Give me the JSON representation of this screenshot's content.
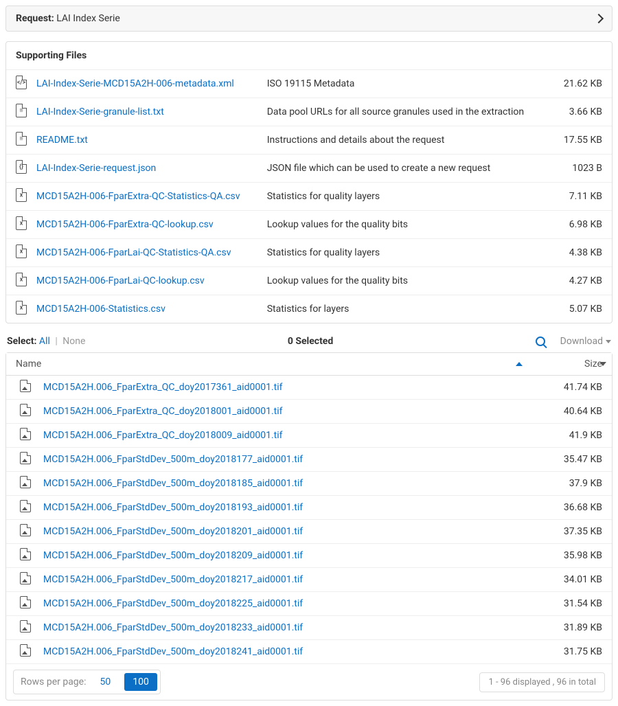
{
  "request": {
    "label": "Request:",
    "name": "LAI Index Serie"
  },
  "supporting": {
    "heading": "Supporting Files",
    "rows": [
      {
        "icon": "xml",
        "name": "LAI-Index-Serie-MCD15A2H-006-metadata.xml",
        "desc": "ISO 19115 Metadata",
        "size": "21.62 KB"
      },
      {
        "icon": "txt",
        "name": "LAI-Index-Serie-granule-list.txt",
        "desc": "Data pool URLs for all source granules used in the extraction",
        "size": "3.66 KB"
      },
      {
        "icon": "txt",
        "name": "README.txt",
        "desc": "Instructions and details about the request",
        "size": "17.55 KB"
      },
      {
        "icon": "json",
        "name": "LAI-Index-Serie-request.json",
        "desc": "JSON file which can be used to create a new request",
        "size": "1023 B"
      },
      {
        "icon": "csv",
        "name": "MCD15A2H-006-FparExtra-QC-Statistics-QA.csv",
        "desc": "Statistics for quality layers",
        "size": "7.11 KB"
      },
      {
        "icon": "csv",
        "name": "MCD15A2H-006-FparExtra-QC-lookup.csv",
        "desc": "Lookup values for the quality bits",
        "size": "6.98 KB"
      },
      {
        "icon": "csv",
        "name": "MCD15A2H-006-FparLai-QC-Statistics-QA.csv",
        "desc": "Statistics for quality layers",
        "size": "4.38 KB"
      },
      {
        "icon": "csv",
        "name": "MCD15A2H-006-FparLai-QC-lookup.csv",
        "desc": "Lookup values for the quality bits",
        "size": "4.27 KB"
      },
      {
        "icon": "csv",
        "name": "MCD15A2H-006-Statistics.csv",
        "desc": "Statistics for layers",
        "size": "5.07 KB"
      }
    ]
  },
  "toolbar": {
    "select_label": "Select:",
    "all": "All",
    "none": "None",
    "selected": "0 Selected",
    "download": "Download"
  },
  "data": {
    "columns": {
      "name": "Name",
      "size": "Size"
    },
    "rows": [
      {
        "name": "MCD15A2H.006_FparExtra_QC_doy2017361_aid0001.tif",
        "size": "41.74 KB"
      },
      {
        "name": "MCD15A2H.006_FparExtra_QC_doy2018001_aid0001.tif",
        "size": "40.64 KB"
      },
      {
        "name": "MCD15A2H.006_FparExtra_QC_doy2018009_aid0001.tif",
        "size": "41.9 KB"
      },
      {
        "name": "MCD15A2H.006_FparStdDev_500m_doy2018177_aid0001.tif",
        "size": "35.47 KB"
      },
      {
        "name": "MCD15A2H.006_FparStdDev_500m_doy2018185_aid0001.tif",
        "size": "37.9 KB"
      },
      {
        "name": "MCD15A2H.006_FparStdDev_500m_doy2018193_aid0001.tif",
        "size": "36.68 KB"
      },
      {
        "name": "MCD15A2H.006_FparStdDev_500m_doy2018201_aid0001.tif",
        "size": "37.35 KB"
      },
      {
        "name": "MCD15A2H.006_FparStdDev_500m_doy2018209_aid0001.tif",
        "size": "35.98 KB"
      },
      {
        "name": "MCD15A2H.006_FparStdDev_500m_doy2018217_aid0001.tif",
        "size": "34.01 KB"
      },
      {
        "name": "MCD15A2H.006_FparStdDev_500m_doy2018225_aid0001.tif",
        "size": "31.54 KB"
      },
      {
        "name": "MCD15A2H.006_FparStdDev_500m_doy2018233_aid0001.tif",
        "size": "31.89 KB"
      },
      {
        "name": "MCD15A2H.006_FparStdDev_500m_doy2018241_aid0001.tif",
        "size": "31.75 KB"
      }
    ]
  },
  "footer": {
    "rows_per_label": "Rows per page:",
    "opt_50": "50",
    "opt_100": "100",
    "page_info": "1 - 96 displayed , 96 in total"
  },
  "icon_glyphs": {
    "xml": "</>",
    "txt": "≡",
    "json": "{}",
    "csv": "x"
  }
}
